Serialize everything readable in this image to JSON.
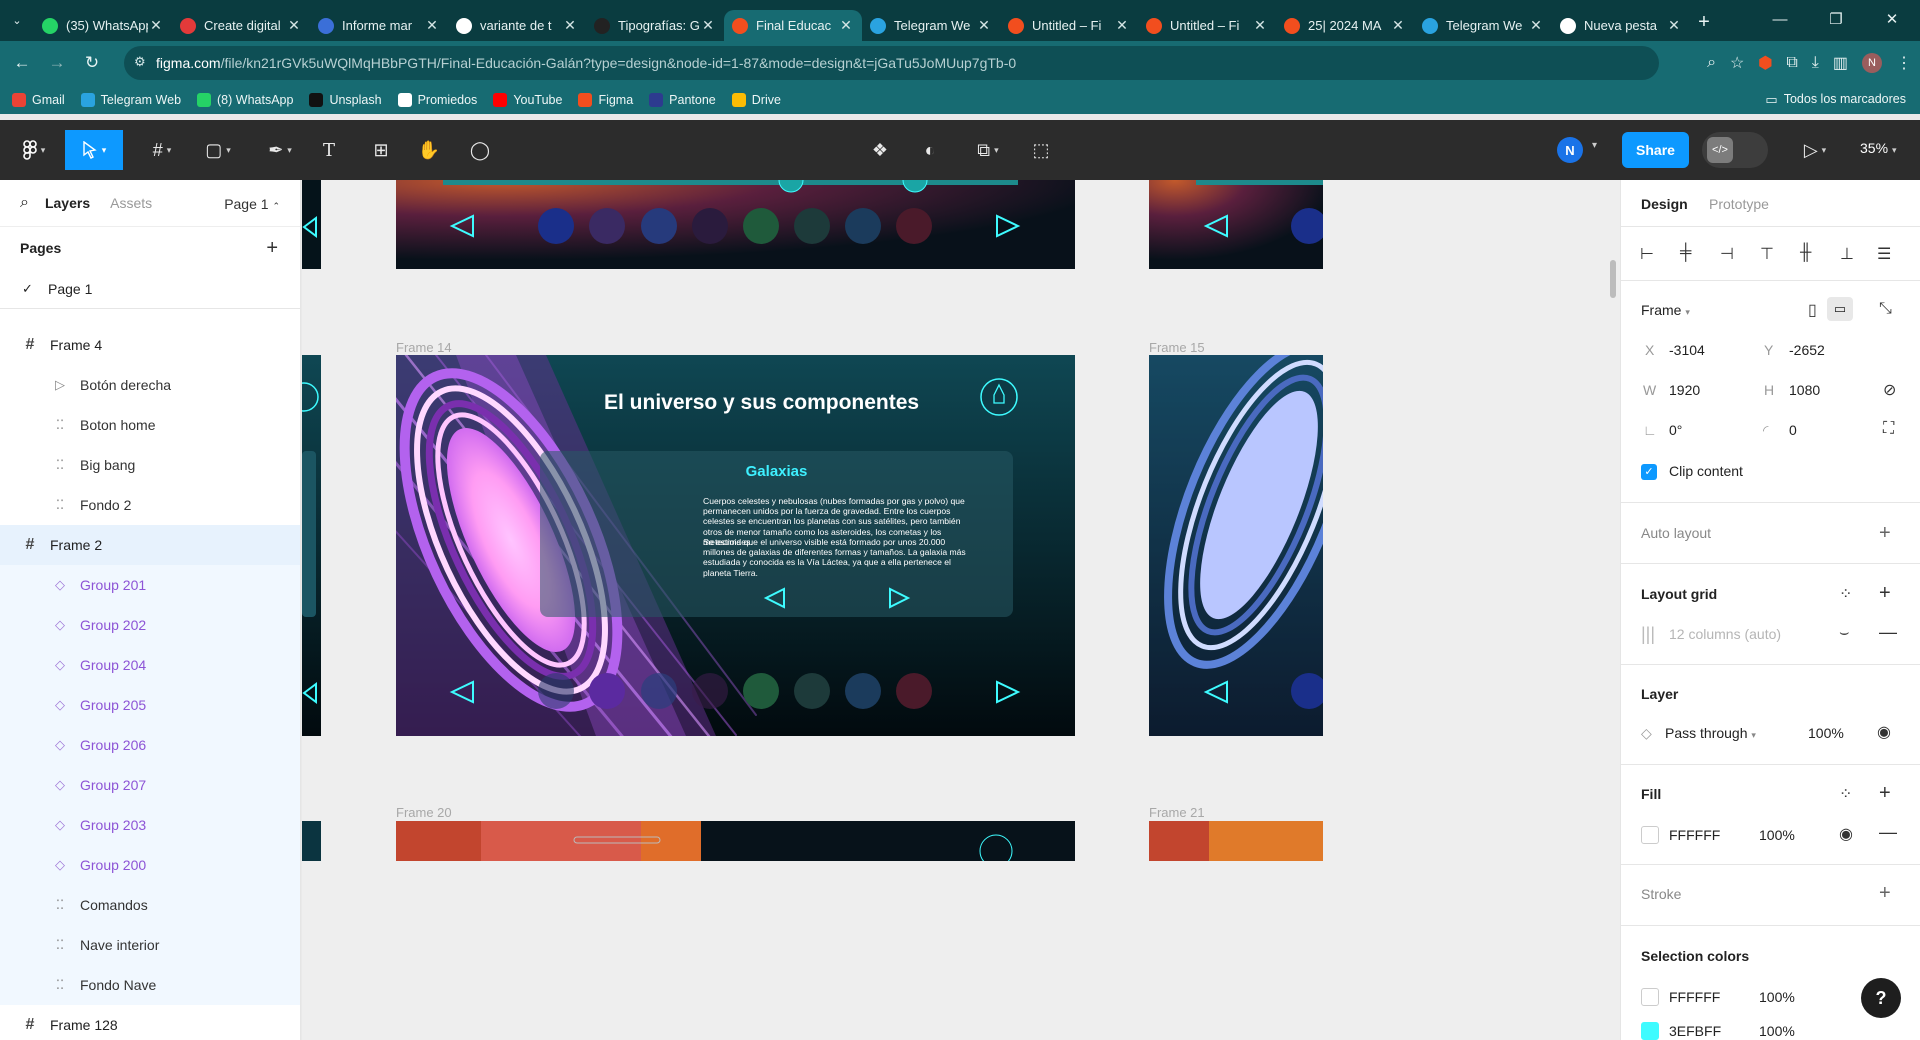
{
  "browser": {
    "tabs": [
      {
        "title": "(35) WhatsApp",
        "icon": "whatsapp-icon",
        "color": "#25d366"
      },
      {
        "title": "Create digital",
        "icon": "canva-icon",
        "color": "#e33a3a"
      },
      {
        "title": "Informe mar",
        "icon": "docs-icon",
        "color": "#3b6fd8"
      },
      {
        "title": "variante de t",
        "icon": "google-icon",
        "color": "#ffffff"
      },
      {
        "title": "Tipografías: G",
        "icon": "notion-icon",
        "color": "#222222"
      },
      {
        "title": "Final Educac",
        "icon": "figma-icon",
        "color": "#f24e1e",
        "active": true
      },
      {
        "title": "Telegram We",
        "icon": "telegram-icon",
        "color": "#2aa3e0"
      },
      {
        "title": "Untitled – Fi",
        "icon": "figma-icon",
        "color": "#f24e1e"
      },
      {
        "title": "Untitled – Fi",
        "icon": "figma-icon",
        "color": "#f24e1e"
      },
      {
        "title": "25| 2024 MA",
        "icon": "figma-icon",
        "color": "#f24e1e"
      },
      {
        "title": "Telegram We",
        "icon": "telegram-icon",
        "color": "#2aa3e0"
      },
      {
        "title": "Nueva pesta",
        "icon": "chrome-icon",
        "color": "#ffffff"
      }
    ],
    "new_tab": "+",
    "url_host": "figma.com",
    "url_path": "/file/kn21rGVk5uWQlMqHBbPGTH/Final-Educación-Galán?type=design&node-id=1-87&mode=design&t=jGaTu5JoMUup7gTb-0",
    "bookmarks": [
      {
        "label": "Gmail",
        "color": "#ea4335"
      },
      {
        "label": "Telegram Web",
        "color": "#2aa3e0"
      },
      {
        "label": "(8) WhatsApp",
        "color": "#25d366"
      },
      {
        "label": "Unsplash",
        "color": "#111111"
      },
      {
        "label": "Promiedos",
        "color": "#ffffff"
      },
      {
        "label": "YouTube",
        "color": "#ff0000"
      },
      {
        "label": "Figma",
        "color": "#f24e1e"
      },
      {
        "label": "Pantone",
        "color": "#2d3b8f"
      },
      {
        "label": "Drive",
        "color": "#fbbc04"
      }
    ],
    "all_bookmarks": "Todos los marcadores"
  },
  "toolbar": {
    "share": "Share",
    "avatar": "N",
    "zoom": "35%"
  },
  "layers_panel": {
    "tab_layers": "Layers",
    "tab_assets": "Assets",
    "page_selector": "Page 1",
    "pages_title": "Pages",
    "pages": [
      "Page 1"
    ],
    "layers": [
      {
        "name": "Frame 4",
        "kind": "frame"
      },
      {
        "name": "Botón derecha",
        "kind": "child",
        "icon": "play"
      },
      {
        "name": "Boton home",
        "kind": "child",
        "icon": "group"
      },
      {
        "name": "Big bang",
        "kind": "child",
        "icon": "group"
      },
      {
        "name": "Fondo 2",
        "kind": "child",
        "icon": "group"
      },
      {
        "name": "Frame 2",
        "kind": "frame",
        "selected": true
      },
      {
        "name": "Group 201",
        "kind": "comp"
      },
      {
        "name": "Group 202",
        "kind": "comp"
      },
      {
        "name": "Group 204",
        "kind": "comp"
      },
      {
        "name": "Group 205",
        "kind": "comp"
      },
      {
        "name": "Group 206",
        "kind": "comp"
      },
      {
        "name": "Group 207",
        "kind": "comp"
      },
      {
        "name": "Group 203",
        "kind": "comp"
      },
      {
        "name": "Group 200",
        "kind": "comp"
      },
      {
        "name": "Comandos",
        "kind": "inside"
      },
      {
        "name": "Nave interior",
        "kind": "inside"
      },
      {
        "name": "Fondo Nave",
        "kind": "inside"
      },
      {
        "name": "Frame 128",
        "kind": "frame"
      }
    ]
  },
  "canvas": {
    "frame_labels": {
      "f14": "Frame 14",
      "f15": "Frame 15",
      "f20": "Frame 20",
      "f21": "Frame 21"
    },
    "slide_title": "El universo y sus  componentes",
    "box_heading": "Galaxias",
    "box_p1": "Cuerpos celestes y nebulosas (nubes formadas por gas y polvo) que permanecen unidos por la fuerza de gravedad. Entre los cuerpos celestes se encuentran los planetas con sus satélites, pero también otros de menor tamaño como los asteroides, los cometas y los meteoroides.",
    "box_p2": "Se estima que el universo visible está formado por unos 20.000 millones de galaxias de diferentes formas y tamaños. La galaxia más estudiada y conocida es la Vía Láctea, ya que a ella pertenece el planeta Tierra."
  },
  "design_panel": {
    "tab_design": "Design",
    "tab_prototype": "Prototype",
    "frame_label": "Frame",
    "x_label": "X",
    "x": "-3104",
    "y_label": "Y",
    "y": "-2652",
    "w_label": "W",
    "w": "1920",
    "h_label": "H",
    "h": "1080",
    "rotation": "0°",
    "radius": "0",
    "clip_content": "Clip content",
    "auto_layout": "Auto layout",
    "layout_grid": "Layout grid",
    "grid_value": "12 columns (auto)",
    "layer": "Layer",
    "blend": "Pass through",
    "opacity": "100%",
    "fill": "Fill",
    "fill_hex": "FFFFFF",
    "fill_opacity": "100%",
    "stroke": "Stroke",
    "selection_colors": "Selection colors",
    "sel_colors": [
      {
        "hex": "FFFFFF",
        "opacity": "100%",
        "swatch": "#ffffff"
      },
      {
        "hex": "3EFBFF",
        "opacity": "100%",
        "swatch": "#3efbff"
      }
    ],
    "help": "?"
  }
}
